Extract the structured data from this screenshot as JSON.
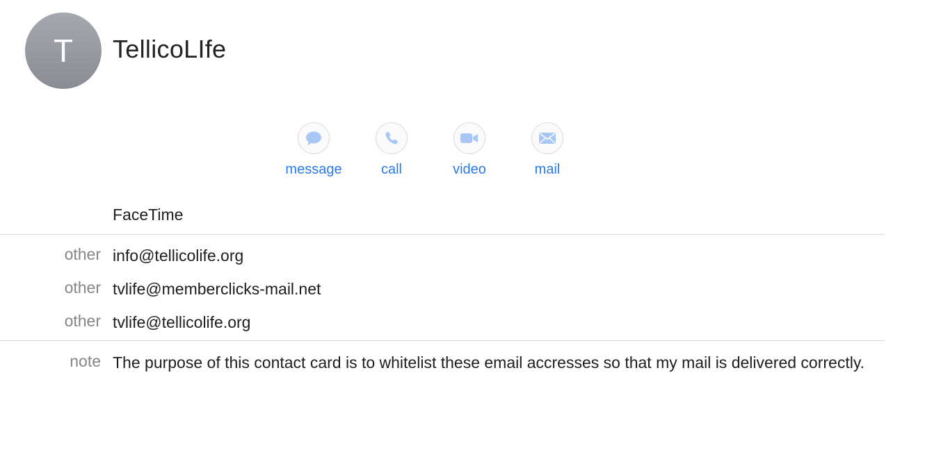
{
  "contact": {
    "initial": "T",
    "name": "TellicoLIfe"
  },
  "actions": [
    {
      "label": "message",
      "icon": "message-bubble-icon"
    },
    {
      "label": "call",
      "icon": "phone-icon"
    },
    {
      "label": "video",
      "icon": "video-camera-icon"
    },
    {
      "label": "mail",
      "icon": "envelope-icon"
    }
  ],
  "facetime_label": "FaceTime",
  "emails": [
    {
      "label": "other",
      "value": "info@tellicolife.org"
    },
    {
      "label": "other",
      "value": "tvlife@memberclicks-mail.net"
    },
    {
      "label": "other",
      "value": "tvlife@tellicolife.org"
    }
  ],
  "note": {
    "label": "note",
    "value": "The purpose of this contact card is to whitelist these email accresses so that my mail is delivered correctly."
  },
  "colors": {
    "accent": "#2b7be5",
    "icon_fill": "#a9c7f5",
    "label_gray": "#858585",
    "avatar": "#9a9ca4"
  }
}
